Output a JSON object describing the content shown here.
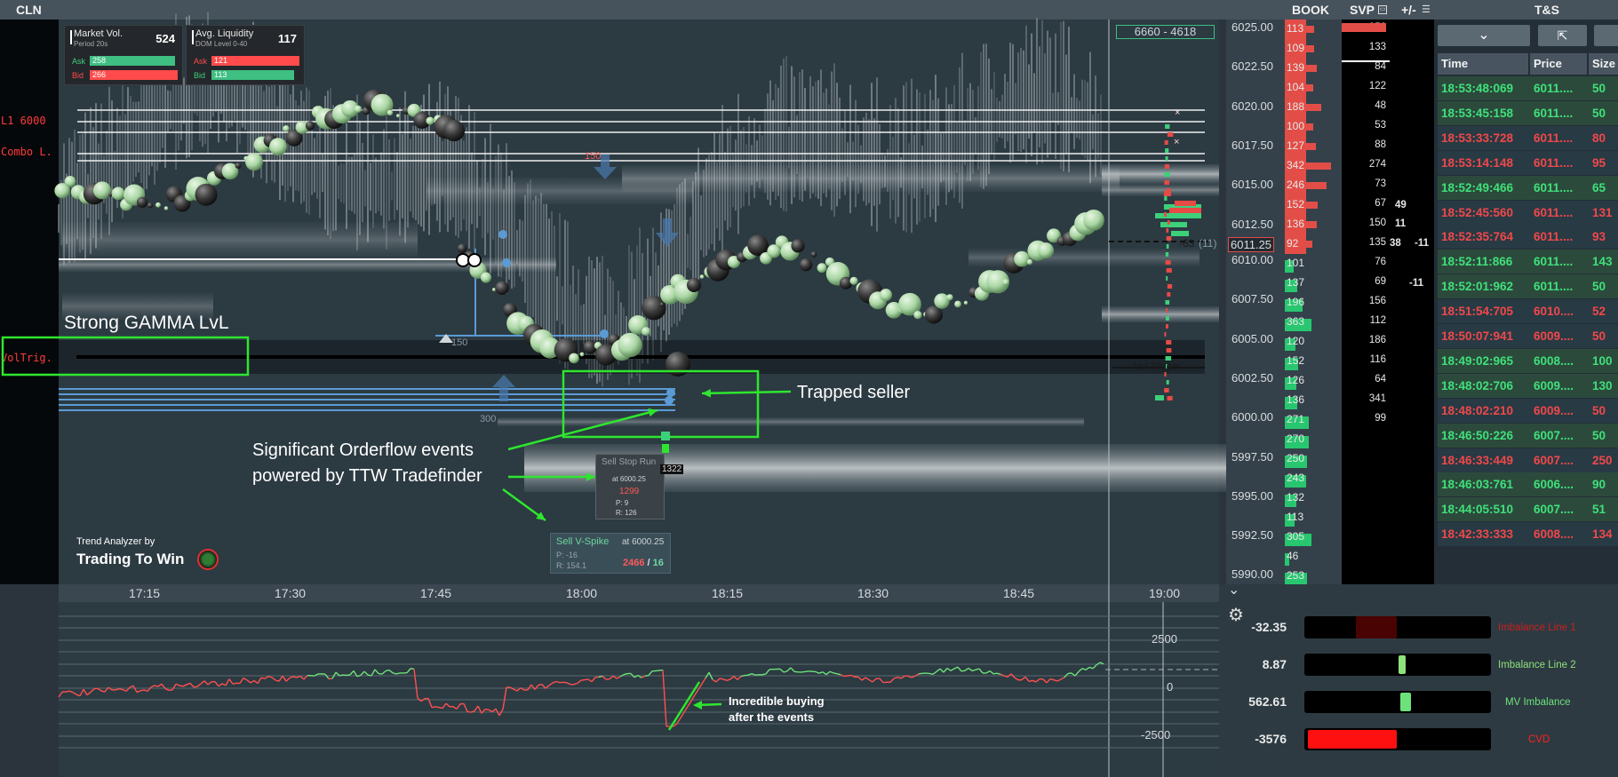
{
  "header": {
    "symbol": "CLN",
    "book": "BOOK",
    "svp": "SVP",
    "pm": "+/-",
    "ts": "T&S"
  },
  "levels": [
    {
      "label": "L1 6000"
    },
    {
      "label": "Combo L."
    },
    {
      "label": "VolTrig."
    }
  ],
  "stats": {
    "market_vol": {
      "title": "Market Vol.",
      "sub": "Period 20s",
      "value": "524",
      "ask_label": "Ask",
      "ask": "258",
      "bid_label": "Bid",
      "bid": "266"
    },
    "liquidity": {
      "title": "Avg. Liquidity",
      "sub": "DOM Level 0-40",
      "value": "117",
      "ask_label": "Ask",
      "ask": "121",
      "bid_label": "Bid",
      "bid": "113"
    }
  },
  "range_badge": "6660 - 4618",
  "chart_annotations": {
    "gamma": "Strong GAMMA LvL",
    "trapped": "Trapped seller",
    "orderflow_line1": "Significant Orderflow events",
    "orderflow_line2": "powered by TTW Tradefinder",
    "vol_trigger": "Vol Trigger",
    "brand_small": "Trend Analyzer by",
    "brand_big": "Trading To Win",
    "lvl_150": "150",
    "lvl_150b": "150",
    "lvl_300": "300",
    "lvl_11": "(11)",
    "lvl_63": "-63"
  },
  "sell_stop": {
    "title": "Sell Stop Run",
    "at": "at 6000.25",
    "value": "1299",
    "p": "P:",
    "p_val": "9",
    "r": "R:",
    "r_val": "126",
    "badge": "1322"
  },
  "sell_spike": {
    "title": "Sell V-Spike",
    "at": "at 6000.25",
    "p": "P:",
    "p_val": "-16",
    "r": "R:",
    "r_val": "154.1",
    "v1": "2466",
    "sep": " / ",
    "v2": "16"
  },
  "price_ticks": [
    "6025.00",
    "6022.50",
    "6020.00",
    "6017.50",
    "6015.00",
    "6012.50",
    "6011.25",
    "6010.00",
    "6007.50",
    "6005.00",
    "6002.50",
    "6000.00",
    "5997.50",
    "5995.00",
    "5992.50",
    "5990.00"
  ],
  "book": [
    "113",
    "109",
    "139",
    "104",
    "188",
    "100",
    "127",
    "342",
    "246",
    "152",
    "136",
    "92",
    "101",
    "137",
    "196",
    "363",
    "120",
    "152",
    "126",
    "136",
    "271",
    "270",
    "250",
    "243",
    "132",
    "113",
    "305",
    "46",
    "253"
  ],
  "svp": [
    "950",
    "133",
    "84",
    "122",
    "48",
    "53",
    "88",
    "274",
    "73",
    "67",
    "150",
    "135",
    "76",
    "69",
    "156",
    "112",
    "186",
    "116",
    "64",
    "341",
    "99"
  ],
  "pm": [
    "49",
    "11",
    "38",
    "-11",
    "-11"
  ],
  "ts": {
    "headers": [
      "Time",
      "Price",
      "Size"
    ],
    "rows": [
      {
        "time": "18:53:48:069",
        "price": "6011....",
        "size": "50",
        "side": "buy"
      },
      {
        "time": "18:53:45:158",
        "price": "6011....",
        "size": "50",
        "side": "buy"
      },
      {
        "time": "18:53:33:728",
        "price": "6011....",
        "size": "80",
        "side": "sell"
      },
      {
        "time": "18:53:14:148",
        "price": "6011....",
        "size": "95",
        "side": "sell"
      },
      {
        "time": "18:52:49:466",
        "price": "6011....",
        "size": "65",
        "side": "buy"
      },
      {
        "time": "18:52:45:560",
        "price": "6011....",
        "size": "131",
        "side": "sell"
      },
      {
        "time": "18:52:35:764",
        "price": "6011....",
        "size": "93",
        "side": "sell"
      },
      {
        "time": "18:52:11:866",
        "price": "6011....",
        "size": "143",
        "side": "buy"
      },
      {
        "time": "18:52:01:962",
        "price": "6011....",
        "size": "50",
        "side": "buy"
      },
      {
        "time": "18:51:54:705",
        "price": "6010....",
        "size": "52",
        "side": "sell"
      },
      {
        "time": "18:50:07:941",
        "price": "6009....",
        "size": "50",
        "side": "sell"
      },
      {
        "time": "18:49:02:965",
        "price": "6008....",
        "size": "100",
        "side": "buy"
      },
      {
        "time": "18:48:02:706",
        "price": "6009....",
        "size": "130",
        "side": "buy"
      },
      {
        "time": "18:48:02:210",
        "price": "6009....",
        "size": "50",
        "side": "sell"
      },
      {
        "time": "18:46:50:226",
        "price": "6007....",
        "size": "50",
        "side": "buy"
      },
      {
        "time": "18:46:33:449",
        "price": "6007....",
        "size": "250",
        "side": "sell"
      },
      {
        "time": "18:46:03:761",
        "price": "6006....",
        "size": "90",
        "side": "buy"
      },
      {
        "time": "18:44:05:510",
        "price": "6007....",
        "size": "51",
        "side": "buy"
      },
      {
        "time": "18:42:33:333",
        "price": "6008....",
        "size": "134",
        "side": "sell"
      }
    ]
  },
  "time_ticks": [
    "17:15",
    "17:30",
    "17:45",
    "18:00",
    "18:15",
    "18:30",
    "18:45",
    "19:00"
  ],
  "lower": {
    "ticks": [
      "2500",
      "0",
      "-2500"
    ],
    "annotation_line1": "Incredible buying",
    "annotation_line2": "after the events"
  },
  "imbalance": [
    {
      "value": "-32.35",
      "label": "Imbalance Line 1",
      "color": "#c8201e"
    },
    {
      "value": "8.87",
      "label": "Imbalance Line 2",
      "color": "#8ee27a"
    },
    {
      "value": "562.61",
      "label": "MV Imbalance",
      "color": "#6ee27a"
    },
    {
      "value": "-3576",
      "label": "CVD",
      "color": "#ff2020"
    }
  ]
}
